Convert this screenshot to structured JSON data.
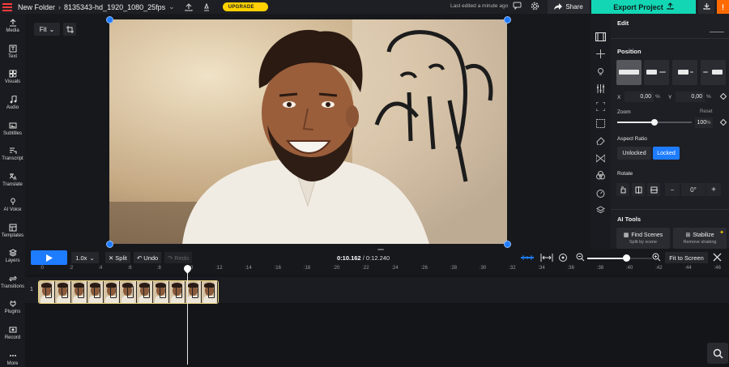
{
  "topbar": {
    "folder": "New Folder",
    "project_name": "8135343-hd_1920_1080_25fps",
    "upgrade_label": "UPGRADE",
    "last_edited": "Last edited a minute ago",
    "share_label": "Share",
    "export_label": "Export Project",
    "more_label": "!"
  },
  "sidebar": {
    "items": [
      {
        "label": "Media",
        "icon": "media-icon"
      },
      {
        "label": "Text",
        "icon": "text-icon"
      },
      {
        "label": "Visuals",
        "icon": "visuals-icon"
      },
      {
        "label": "Audio",
        "icon": "audio-icon"
      },
      {
        "label": "Subtitles",
        "icon": "subtitles-icon"
      },
      {
        "label": "Transcript",
        "icon": "transcript-icon"
      },
      {
        "label": "Translate",
        "icon": "translate-icon"
      },
      {
        "label": "AI Voice",
        "icon": "ai-voice-icon"
      },
      {
        "label": "Templates",
        "icon": "templates-icon"
      },
      {
        "label": "Layers",
        "icon": "layers-icon"
      },
      {
        "label": "Transitions",
        "icon": "transitions-icon"
      },
      {
        "label": "Plugins",
        "icon": "plugins-icon"
      },
      {
        "label": "Record",
        "icon": "record-icon"
      },
      {
        "label": "More",
        "icon": "more-icon"
      }
    ]
  },
  "canvas": {
    "fit_label": "Fit"
  },
  "panel": {
    "edit_title": "Edit",
    "position_title": "Position",
    "x_label": "X",
    "x_value": "0,00",
    "y_label": "Y",
    "y_value": "0,00",
    "percent": "%",
    "zoom_label": "Zoom",
    "reset_label": "Reset",
    "zoom_value": "100",
    "zoom_fraction": 0.5,
    "aspect_title": "Aspect Ratio",
    "unlocked_label": "Unlocked",
    "locked_label": "Locked",
    "rotate_title": "Rotate",
    "rotate_value": "0°",
    "rotate_minus": "−",
    "rotate_plus": "+",
    "ai_tools_title": "AI Tools",
    "find_scenes_label": "Find Scenes",
    "find_scenes_sub": "Split by scene",
    "stabilize_label": "Stabilize",
    "stabilize_sub": "Remove shaking"
  },
  "timeline": {
    "speed": "1.0x",
    "split_label": "Split",
    "undo_label": "Undo",
    "redo_label": "Redo",
    "current_time": "0:10.162",
    "total_time": "0:12.240",
    "time_sep": "/",
    "fit_screen_label": "Fit to Screen",
    "track_number": "1",
    "ruler": [
      ":0",
      ":2",
      ":4",
      ":6",
      ":8",
      ":10",
      ":12",
      ":14",
      ":16",
      ":18",
      ":20",
      ":22",
      ":24",
      ":26",
      ":28",
      ":30",
      ":32",
      ":34",
      ":36",
      ":38",
      ":40",
      ":42",
      ":44",
      ":46"
    ]
  },
  "colors": {
    "accent_blue": "#1e7cff",
    "export_green": "#13d6b4",
    "upgrade_yellow": "#ffd100",
    "alert_orange": "#ff6a00"
  }
}
